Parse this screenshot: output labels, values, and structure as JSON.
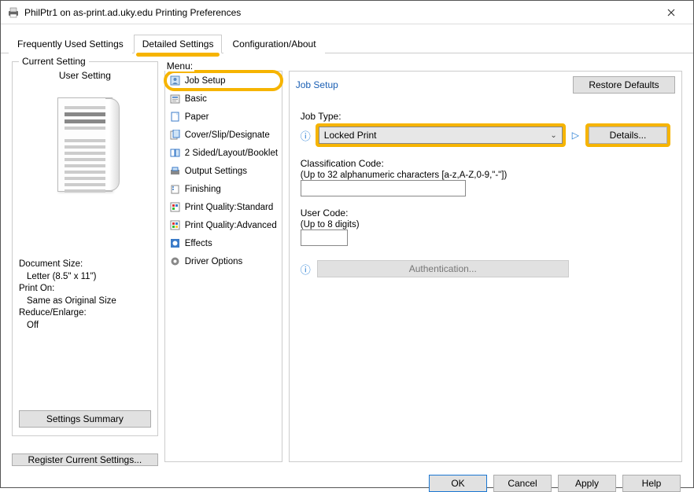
{
  "title": "PhilPtr1 on as-print.ad.uky.edu Printing Preferences",
  "tabs": {
    "frequent": "Frequently Used Settings",
    "detailed": "Detailed Settings",
    "config": "Configuration/About"
  },
  "left": {
    "fieldset_title": "Current Setting",
    "setting_name": "User Setting",
    "doc_size_label": "Document Size:",
    "doc_size_value": "Letter (8.5\" x 11\")",
    "print_on_label": "Print On:",
    "print_on_value": "Same as Original Size",
    "reduce_label": "Reduce/Enlarge:",
    "reduce_value": "Off",
    "settings_summary": "Settings Summary",
    "register": "Register Current Settings..."
  },
  "menu": {
    "label": "Menu:",
    "items": [
      "Job Setup",
      "Basic",
      "Paper",
      "Cover/Slip/Designate",
      "2 Sided/Layout/Booklet",
      "Output Settings",
      "Finishing",
      "Print Quality:Standard",
      "Print Quality:Advanced",
      "Effects",
      "Driver Options"
    ]
  },
  "detail": {
    "heading": "Job Setup",
    "restore": "Restore Defaults",
    "job_type_label": "Job Type:",
    "job_type_value": "Locked Print",
    "details_btn": "Details...",
    "class_label": "Classification Code:",
    "class_hint": "(Up to 32 alphanumeric characters [a-z,A-Z,0-9,\"-\"])",
    "class_value": "",
    "user_code_label": "User Code:",
    "user_code_hint": "(Up to 8 digits)",
    "user_code_value": "",
    "auth_btn": "Authentication..."
  },
  "buttons": {
    "ok": "OK",
    "cancel": "Cancel",
    "apply": "Apply",
    "help": "Help"
  }
}
